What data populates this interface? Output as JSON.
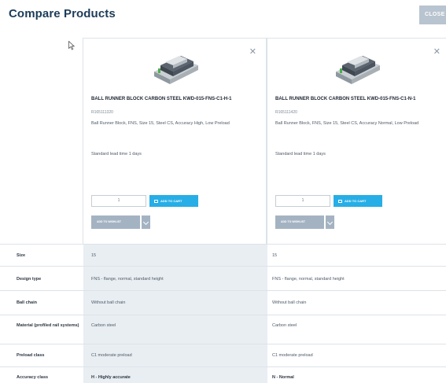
{
  "header": {
    "title": "Compare Products",
    "close_label": "CLOSE"
  },
  "products": [
    {
      "name": "BALL RUNNER BLOCK CARBON STEEL KWD-015-FNS-C1-H-1",
      "sku": "R165111320",
      "description": "Ball Runner Block, FNS, Size 15, Steel CS, Accuracy High, Low Preload",
      "lead_time": "Standard lead time 1 days",
      "quantity": "1",
      "add_to_cart": "ADD TO CART",
      "add_to_wishlist": "ADD TO WISHLIST"
    },
    {
      "name": "BALL RUNNER BLOCK CARBON STEEL KWD-015-FNS-C1-N-1",
      "sku": "R165111420",
      "description": "Ball Runner Block, FNS, Size 15, Steel CS, Accuracy Normal, Low Preload",
      "lead_time": "Standard lead time 1 days",
      "quantity": "1",
      "add_to_cart": "ADD TO CART",
      "add_to_wishlist": "ADD TO WISHLIST"
    }
  ],
  "specs": [
    {
      "label": "Size",
      "values": [
        "15",
        "15"
      ]
    },
    {
      "label": "Design type",
      "values": [
        "FNS - flange, normal, standard height",
        "FNS - flange, normal, standard height"
      ]
    },
    {
      "label": "Ball chain",
      "values": [
        "Without ball chain",
        "Without ball chain"
      ]
    },
    {
      "label": "Material (profiled rail systems)",
      "values": [
        "Carbon steel",
        "Carbon steel"
      ]
    },
    {
      "label": "Preload class",
      "values": [
        "C1 moderate preload",
        "C1 moderate preload"
      ]
    },
    {
      "label": "Accuracy class",
      "values": [
        "H - Highly accurate",
        "N - Normal"
      ]
    }
  ],
  "colors": {
    "title": "#1c3c5a",
    "cart_button": "#27aee6",
    "wishlist_button": "#a4b3c2",
    "highlight_column": "#e9eef3",
    "close_button": "#b8c4cf"
  }
}
